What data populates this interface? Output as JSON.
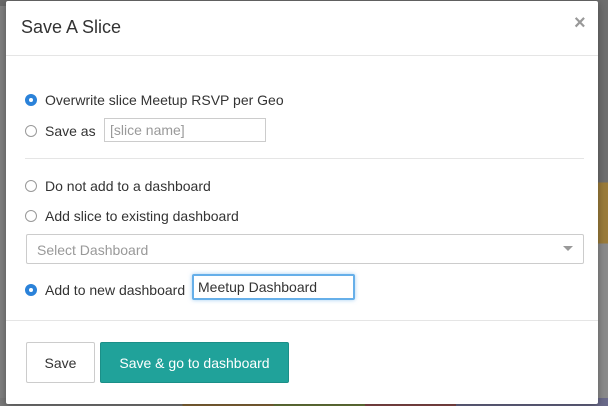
{
  "modal": {
    "title": "Save A Slice",
    "close_glyph": "×"
  },
  "save_options": {
    "overwrite_label": "Overwrite slice Meetup RSVP per Geo",
    "overwrite_checked": true,
    "save_as_label": "Save as",
    "save_as_checked": false,
    "slice_name_placeholder": "[slice name]",
    "slice_name_value": ""
  },
  "dashboard_options": {
    "none_label": "Do not add to a dashboard",
    "none_checked": false,
    "existing_label": "Add slice to existing dashboard",
    "existing_checked": false,
    "select_placeholder": "Select Dashboard",
    "new_label": "Add to new dashboard",
    "new_checked": true,
    "new_dashboard_value": "Meetup Dashboard"
  },
  "footer": {
    "save_label": "Save",
    "save_go_label": "Save & go to dashboard"
  },
  "colors": {
    "accent": "#20a29a",
    "radio_checked": "#2b82d9",
    "focus_border": "#66afe9"
  }
}
